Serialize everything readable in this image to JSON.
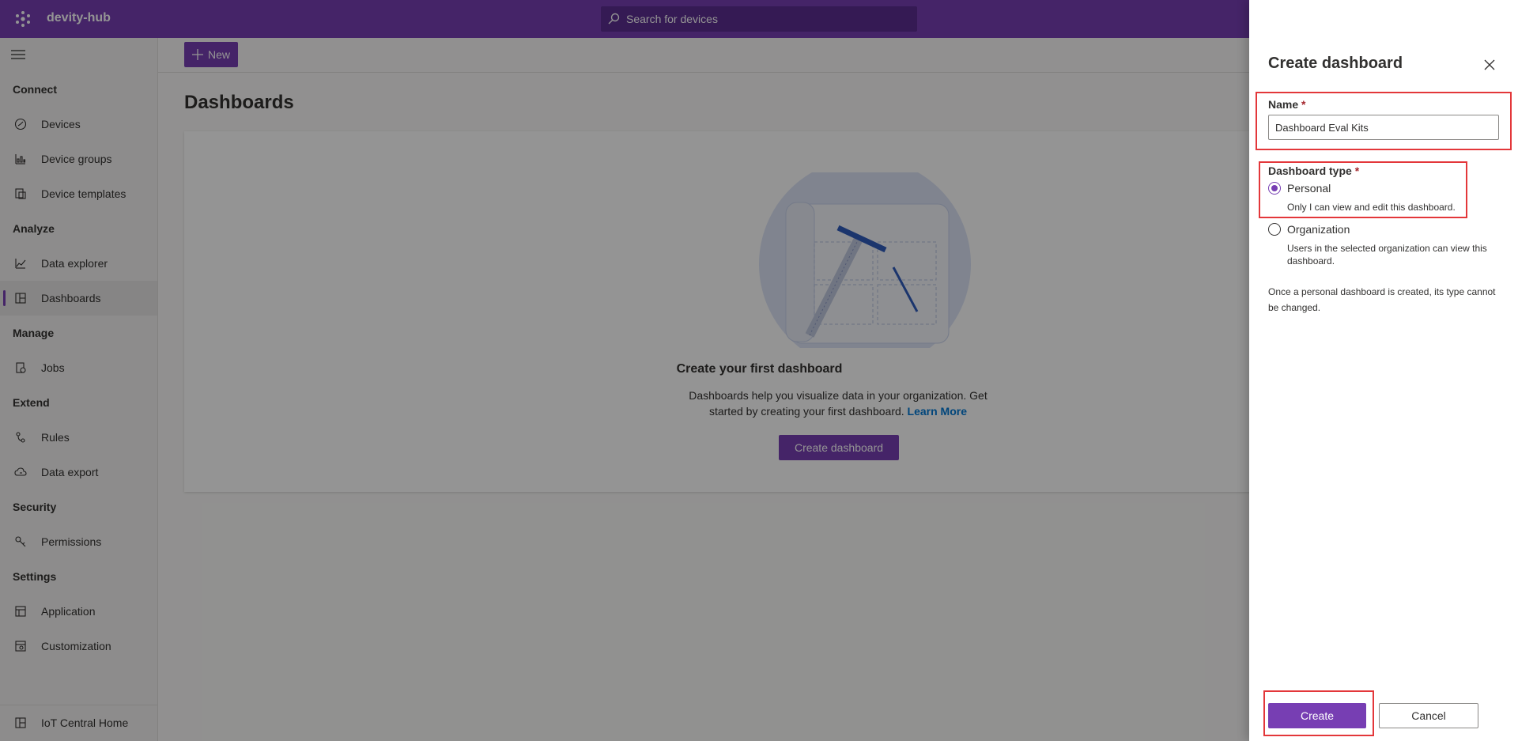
{
  "app": {
    "name": "devity-hub"
  },
  "search": {
    "placeholder": "Search for devices"
  },
  "topbar": {
    "icons": [
      "settings-icon",
      "help-icon",
      "profile-icon"
    ]
  },
  "sidebar": {
    "sections": [
      {
        "title": "Connect",
        "items": [
          {
            "label": "Devices",
            "icon": "devices-icon"
          },
          {
            "label": "Device groups",
            "icon": "device-groups-icon"
          },
          {
            "label": "Device templates",
            "icon": "device-templates-icon"
          }
        ]
      },
      {
        "title": "Analyze",
        "items": [
          {
            "label": "Data explorer",
            "icon": "chart-icon"
          },
          {
            "label": "Dashboards",
            "icon": "dashboard-icon",
            "active": true
          }
        ]
      },
      {
        "title": "Manage",
        "items": [
          {
            "label": "Jobs",
            "icon": "jobs-icon"
          }
        ]
      },
      {
        "title": "Extend",
        "items": [
          {
            "label": "Rules",
            "icon": "rules-icon"
          },
          {
            "label": "Data export",
            "icon": "data-export-icon"
          }
        ]
      },
      {
        "title": "Security",
        "items": [
          {
            "label": "Permissions",
            "icon": "permissions-icon"
          }
        ]
      },
      {
        "title": "Settings",
        "items": [
          {
            "label": "Application",
            "icon": "application-icon"
          },
          {
            "label": "Customization",
            "icon": "customization-icon"
          }
        ]
      }
    ],
    "bottom": {
      "label": "IoT Central Home"
    }
  },
  "commandbar": {
    "new_label": "New"
  },
  "page": {
    "title": "Dashboards",
    "empty_title": "Create your first dashboard",
    "empty_desc": "Dashboards help you visualize data in your organization. Get started by creating your first dashboard.",
    "learn_more": "Learn More",
    "create_button": "Create dashboard"
  },
  "panel": {
    "title": "Create dashboard",
    "name_label": "Name",
    "required_mark": "*",
    "name_value": "Dashboard Eval Kits",
    "type_label": "Dashboard type",
    "options": [
      {
        "label": "Personal",
        "desc": "Only I can view and edit this dashboard.",
        "checked": true
      },
      {
        "label": "Organization",
        "desc": "Users in the selected organization can view this dashboard.",
        "checked": false
      }
    ],
    "note": "Once a personal dashboard is created, its type cannot be changed.",
    "create_label": "Create",
    "cancel_label": "Cancel"
  },
  "colors": {
    "accent": "#773eb3",
    "highlight": "#e3373a"
  }
}
